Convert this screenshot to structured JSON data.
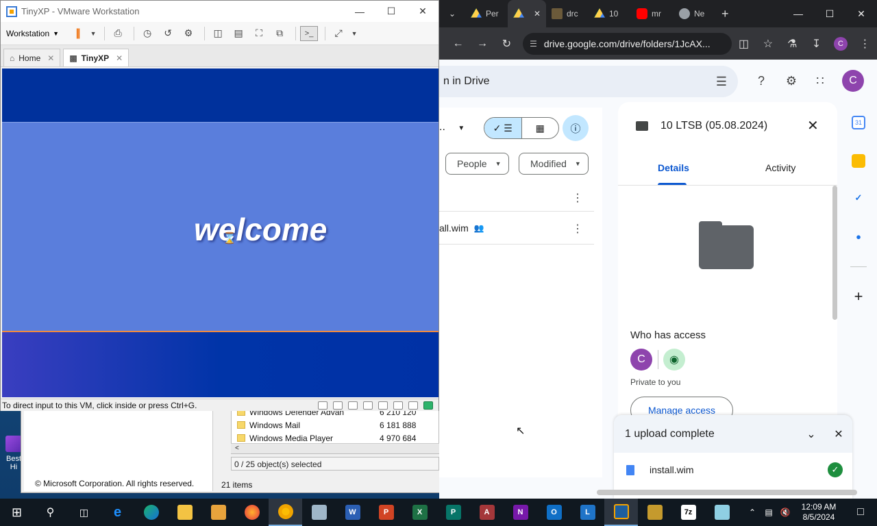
{
  "desktop": {
    "icon_label": "Best Hi",
    "bg_window": {
      "copyright": "© Microsoft Corporation. All rights reserved.",
      "rows": [
        {
          "name": "Windows Defender Advan",
          "size": "6 210 120"
        },
        {
          "name": "Windows Mail",
          "size": "6 181 888"
        },
        {
          "name": "Windows Media Player",
          "size": "4 970 684"
        }
      ],
      "status": "0 / 25 object(s) selected",
      "items_count": "21 items"
    }
  },
  "vmware": {
    "title": "TinyXP - VMware Workstation",
    "menu_label": "Workstation",
    "tabs": [
      {
        "label": "Home",
        "icon": "home-icon"
      },
      {
        "label": "TinyXP",
        "icon": "vm-icon"
      }
    ],
    "screen_text": "welcome",
    "status_message": "To direct input to this VM, click inside or press Ctrl+G."
  },
  "chrome": {
    "tabs": [
      {
        "label": "Per",
        "icon": "drive",
        "active": false
      },
      {
        "label": "",
        "icon": "drive",
        "active": true
      },
      {
        "label": "drc",
        "icon": "drc",
        "active": false
      },
      {
        "label": "10",
        "icon": "drive",
        "active": false
      },
      {
        "label": "mr",
        "icon": "yt",
        "active": false
      },
      {
        "label": "Ne",
        "icon": "ne",
        "active": false
      }
    ],
    "url": "drive.google.com/drive/folders/1JcAX...",
    "profile_initial": "C"
  },
  "drive": {
    "search_placeholder": "n in Drive",
    "avatar_initial": "C",
    "folder_crumb": "..",
    "filters": {
      "people": "People",
      "modified": "Modified"
    },
    "file_name": "all.wim",
    "details": {
      "title": "10 LTSB (05.08.2024)",
      "tab_details": "Details",
      "tab_activity": "Activity",
      "who_has_access": "Who has access",
      "avatar_initial": "C",
      "private_text": "Private to you",
      "manage_access": "Manage access"
    },
    "upload": {
      "title": "1 upload complete",
      "file_name": "install.wim"
    },
    "accent_color": "#0b57d0"
  },
  "taskbar": {
    "apps": [
      "start",
      "search",
      "task-view",
      "ie",
      "edge",
      "explorer",
      "media",
      "firefox",
      "chrome",
      "vmware-old",
      "word",
      "powerpoint",
      "excel",
      "publisher",
      "access",
      "onenote",
      "outlook",
      "lync",
      "vmware",
      "winrar",
      "7zip",
      "notepad"
    ],
    "time": "12:09 AM",
    "date": "8/5/2024"
  }
}
